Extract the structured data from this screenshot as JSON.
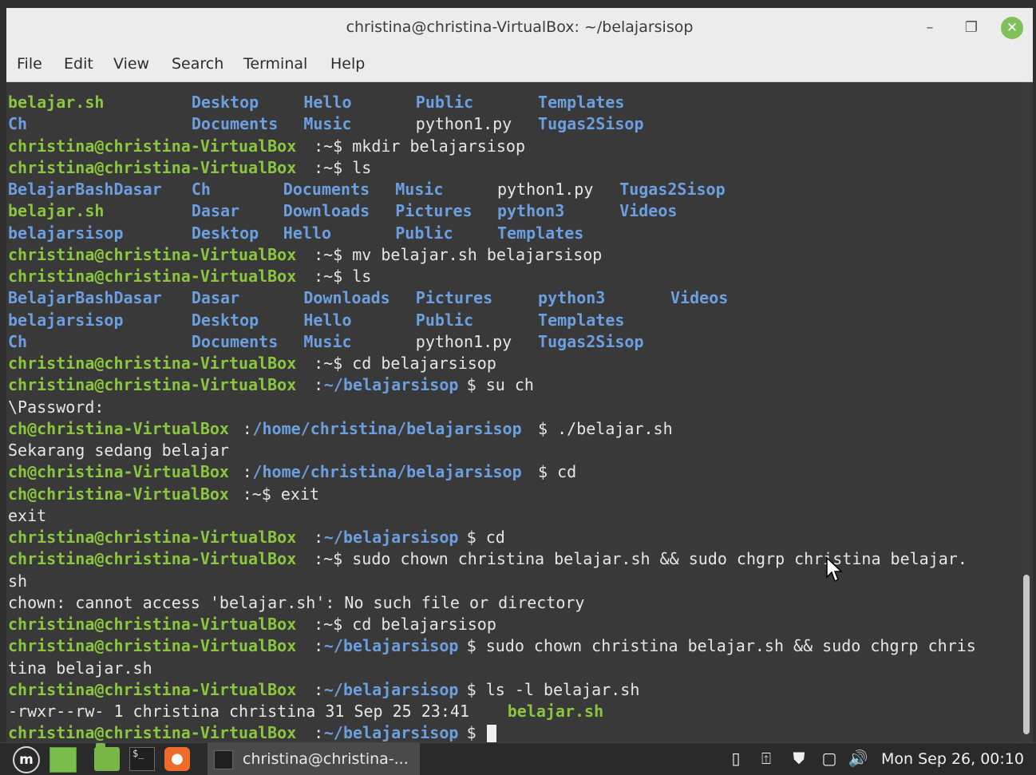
{
  "window": {
    "title": "christina@christina-VirtualBox: ~/belajarsisop",
    "minimize": "–",
    "maximize": "❐",
    "close": "✕"
  },
  "menu": [
    "File",
    "Edit",
    "View",
    "Search",
    "Terminal",
    "Help"
  ],
  "colors": {
    "terminal_bg": "#393939",
    "prompt_green": "#8ac63e",
    "dir_blue": "#6c9fe0",
    "text": "#e6e6e6"
  },
  "terminal_lines": [
    [
      {
        "t": "belajar.sh",
        "c": "g",
        "col": 0
      },
      {
        "t": "Desktop",
        "c": "b",
        "col": 18
      },
      {
        "t": "Hello",
        "c": "b",
        "col": 29
      },
      {
        "t": "Public",
        "c": "b",
        "col": 40
      },
      {
        "t": "Templates",
        "c": "b",
        "col": 52
      }
    ],
    [
      {
        "t": "Ch",
        "c": "b",
        "col": 0
      },
      {
        "t": "Documents",
        "c": "b",
        "col": 18
      },
      {
        "t": "Music",
        "c": "b",
        "col": 29
      },
      {
        "t": "python1.py",
        "c": "w",
        "col": 40
      },
      {
        "t": "Tugas2Sisop",
        "c": "b",
        "col": 52
      }
    ],
    [
      {
        "t": "christina@christina-VirtualBox",
        "c": "g",
        "col": 0
      },
      {
        "t": ":~$ mkdir belajarsisop",
        "c": "w",
        "col": 30
      }
    ],
    [
      {
        "t": "christina@christina-VirtualBox",
        "c": "g",
        "col": 0
      },
      {
        "t": ":~$ ls",
        "c": "w",
        "col": 30
      }
    ],
    [
      {
        "t": "BelajarBashDasar",
        "c": "b",
        "col": 0
      },
      {
        "t": "Ch",
        "c": "b",
        "col": 18
      },
      {
        "t": "Documents",
        "c": "b",
        "col": 27
      },
      {
        "t": "Music",
        "c": "b",
        "col": 38
      },
      {
        "t": "python1.py",
        "c": "w",
        "col": 48
      },
      {
        "t": "Tugas2Sisop",
        "c": "b",
        "col": 60
      }
    ],
    [
      {
        "t": "belajar.sh",
        "c": "g",
        "col": 0
      },
      {
        "t": "Dasar",
        "c": "b",
        "col": 18
      },
      {
        "t": "Downloads",
        "c": "b",
        "col": 27
      },
      {
        "t": "Pictures",
        "c": "b",
        "col": 38
      },
      {
        "t": "python3",
        "c": "b",
        "col": 48
      },
      {
        "t": "Videos",
        "c": "b",
        "col": 60
      }
    ],
    [
      {
        "t": "belajarsisop",
        "c": "b",
        "col": 0
      },
      {
        "t": "Desktop",
        "c": "b",
        "col": 18
      },
      {
        "t": "Hello",
        "c": "b",
        "col": 27
      },
      {
        "t": "Public",
        "c": "b",
        "col": 38
      },
      {
        "t": "Templates",
        "c": "b",
        "col": 48
      }
    ],
    [
      {
        "t": "christina@christina-VirtualBox",
        "c": "g",
        "col": 0
      },
      {
        "t": ":~$ mv belajar.sh belajarsisop",
        "c": "w",
        "col": 30
      }
    ],
    [
      {
        "t": "christina@christina-VirtualBox",
        "c": "g",
        "col": 0
      },
      {
        "t": ":~$ ls",
        "c": "w",
        "col": 30
      }
    ],
    [
      {
        "t": "BelajarBashDasar",
        "c": "b",
        "col": 0
      },
      {
        "t": "Dasar",
        "c": "b",
        "col": 18
      },
      {
        "t": "Downloads",
        "c": "b",
        "col": 29
      },
      {
        "t": "Pictures",
        "c": "b",
        "col": 40
      },
      {
        "t": "python3",
        "c": "b",
        "col": 52
      },
      {
        "t": "Videos",
        "c": "b",
        "col": 65
      }
    ],
    [
      {
        "t": "belajarsisop",
        "c": "b",
        "col": 0
      },
      {
        "t": "Desktop",
        "c": "b",
        "col": 18
      },
      {
        "t": "Hello",
        "c": "b",
        "col": 29
      },
      {
        "t": "Public",
        "c": "b",
        "col": 40
      },
      {
        "t": "Templates",
        "c": "b",
        "col": 52
      }
    ],
    [
      {
        "t": "Ch",
        "c": "b",
        "col": 0
      },
      {
        "t": "Documents",
        "c": "b",
        "col": 18
      },
      {
        "t": "Music",
        "c": "b",
        "col": 29
      },
      {
        "t": "python1.py",
        "c": "w",
        "col": 40
      },
      {
        "t": "Tugas2Sisop",
        "c": "b",
        "col": 52
      }
    ],
    [
      {
        "t": "christina@christina-VirtualBox",
        "c": "g",
        "col": 0
      },
      {
        "t": ":~$ cd belajarsisop",
        "c": "w",
        "col": 30
      }
    ],
    [
      {
        "t": "christina@christina-VirtualBox",
        "c": "g",
        "col": 0
      },
      {
        "t": ":",
        "c": "w",
        "col": 30
      },
      {
        "t": "~/belajarsisop",
        "c": "b",
        "col": 31
      },
      {
        "t": "$ su ch",
        "c": "w",
        "col": 45
      }
    ],
    [
      {
        "t": "\\Password:",
        "c": "w",
        "col": 0
      }
    ],
    [
      {
        "t": "ch@christina-VirtualBox",
        "c": "g",
        "col": 0
      },
      {
        "t": ":",
        "c": "w",
        "col": 23
      },
      {
        "t": "/home/christina/belajarsisop",
        "c": "b",
        "col": 24
      },
      {
        "t": "$ ./belajar.sh",
        "c": "w",
        "col": 52
      }
    ],
    [
      {
        "t": "Sekarang sedang belajar",
        "c": "w",
        "col": 0
      }
    ],
    [
      {
        "t": "ch@christina-VirtualBox",
        "c": "g",
        "col": 0
      },
      {
        "t": ":",
        "c": "w",
        "col": 23
      },
      {
        "t": "/home/christina/belajarsisop",
        "c": "b",
        "col": 24
      },
      {
        "t": "$ cd",
        "c": "w",
        "col": 52
      }
    ],
    [
      {
        "t": "ch@christina-VirtualBox",
        "c": "g",
        "col": 0
      },
      {
        "t": ":~$ exit",
        "c": "w",
        "col": 23
      }
    ],
    [
      {
        "t": "exit",
        "c": "w",
        "col": 0
      }
    ],
    [
      {
        "t": "christina@christina-VirtualBox",
        "c": "g",
        "col": 0
      },
      {
        "t": ":",
        "c": "w",
        "col": 30
      },
      {
        "t": "~/belajarsisop",
        "c": "b",
        "col": 31
      },
      {
        "t": "$ cd",
        "c": "w",
        "col": 45
      }
    ],
    [
      {
        "t": "christina@christina-VirtualBox",
        "c": "g",
        "col": 0
      },
      {
        "t": ":~$ sudo chown christina belajar.sh && sudo chgrp christina belajar.",
        "c": "w",
        "col": 30
      }
    ],
    [
      {
        "t": "sh",
        "c": "w",
        "col": 0
      }
    ],
    [
      {
        "t": "chown: cannot access 'belajar.sh': No such file or directory",
        "c": "w",
        "col": 0
      }
    ],
    [
      {
        "t": "christina@christina-VirtualBox",
        "c": "g",
        "col": 0
      },
      {
        "t": ":~$ cd belajarsisop",
        "c": "w",
        "col": 30
      }
    ],
    [
      {
        "t": "christina@christina-VirtualBox",
        "c": "g",
        "col": 0
      },
      {
        "t": ":",
        "c": "w",
        "col": 30
      },
      {
        "t": "~/belajarsisop",
        "c": "b",
        "col": 31
      },
      {
        "t": "$ sudo chown christina belajar.sh && sudo chgrp chris",
        "c": "w",
        "col": 45
      }
    ],
    [
      {
        "t": "tina belajar.sh",
        "c": "w",
        "col": 0
      }
    ],
    [
      {
        "t": "christina@christina-VirtualBox",
        "c": "g",
        "col": 0
      },
      {
        "t": ":",
        "c": "w",
        "col": 30
      },
      {
        "t": "~/belajarsisop",
        "c": "b",
        "col": 31
      },
      {
        "t": "$ ls -l belajar.sh",
        "c": "w",
        "col": 45
      }
    ],
    [
      {
        "t": "-rwxr--rw- 1 christina christina 31 Sep 25 23:41 ",
        "c": "w",
        "col": 0
      },
      {
        "t": "belajar.sh",
        "c": "g",
        "col": 49
      }
    ],
    [
      {
        "t": "christina@christina-VirtualBox",
        "c": "g",
        "col": 0
      },
      {
        "t": ":",
        "c": "w",
        "col": 30
      },
      {
        "t": "~/belajarsisop",
        "c": "b",
        "col": 31
      },
      {
        "t": "$ ",
        "c": "w",
        "col": 45
      },
      {
        "t": "",
        "c": "cursor",
        "col": 47
      }
    ]
  ],
  "scroll_position": 0.95,
  "taskbar": {
    "menu_icon": "mint-menu-icon",
    "launchers": [
      "show-desktop-icon",
      "files-icon",
      "terminal-icon",
      "firefox-icon"
    ],
    "terminal_glyph": "$_",
    "fox_glyph": "ὒ5",
    "mint_glyph": "m",
    "task_label": "christina@christina-...",
    "tray_icons": [
      "sd-card-icon",
      "update-manager-icon",
      "shield-icon",
      "network-icon",
      "volume-icon"
    ],
    "tray_glyphs": [
      "▯",
      "⍐",
      "⛊",
      "▢",
      "🔊"
    ],
    "clock": "Mon Sep 26, 00:10"
  }
}
